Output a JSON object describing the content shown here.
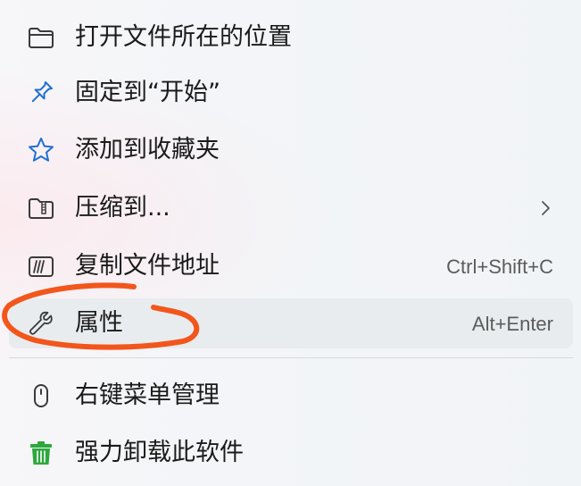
{
  "menu": {
    "items": [
      {
        "icon": "folder-icon",
        "label": "打开文件所在的位置",
        "shortcut": ""
      },
      {
        "icon": "pin-icon",
        "label": "固定到“开始”",
        "shortcut": ""
      },
      {
        "icon": "star-icon",
        "label": "添加到收藏夹",
        "shortcut": ""
      },
      {
        "icon": "zip-folder-icon",
        "label": "压缩到...",
        "shortcut": "",
        "submenu": "chevron-right-icon"
      },
      {
        "icon": "copy-path-icon",
        "label": "复制文件地址",
        "shortcut": "Ctrl+Shift+C"
      },
      {
        "icon": "wrench-icon",
        "label": "属性",
        "shortcut": "Alt+Enter",
        "highlighted": true
      },
      {
        "icon": "mouse-icon",
        "label": "右键菜单管理",
        "shortcut": ""
      },
      {
        "icon": "trash-icon",
        "label": "强力卸载此软件",
        "shortcut": ""
      }
    ]
  },
  "colors": {
    "text": "#1b1b1b",
    "shortcut_text": "#5c5c5c",
    "hover_bg": "#e9ecef",
    "accent_blue": "#1f6fd1",
    "annotation_orange": "#f2561b",
    "trash_green": "#2ca83c"
  },
  "annotation": {
    "type": "freehand-circle",
    "color": "#f2561b",
    "target": "属性"
  }
}
